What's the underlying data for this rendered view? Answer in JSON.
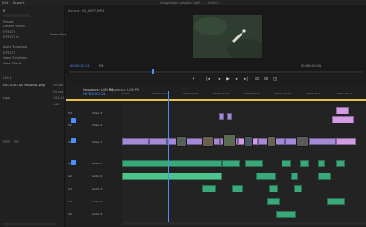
{
  "header": {
    "menu_left": "Edit",
    "menu_right": "Export",
    "project_title": "Vangellsen sessile Ouff",
    "project_state": "- Edited"
  },
  "left_panel": {
    "tab_label": "Ef",
    "rows": [
      "Presets",
      "Lumetri Presets",
      "EFFECTS",
      "EFFECTS in",
      "Audio Transitions",
      "EFFECTS",
      "Video Transitions",
      "Video Effects",
      "LDG 1",
      "LOG LOGO DE ORIGINAL.png",
      "Logo"
    ],
    "right_labels": [
      "5:0 sec",
      "6:0 sec",
      "1:01:11",
      "0:08"
    ],
    "frame_rate_label": "Frame Rate"
  },
  "monitor": {
    "source_label": "Source: GG_IMGT.MP4",
    "timecode_left": "00:00:03:21",
    "fit_label": "Fit",
    "timecode_right": "00:00:41:04",
    "playhead_percent": 28
  },
  "timeline": {
    "tabs": [
      "Sequence: LGH P4",
      "Sequence: LGH P5"
    ],
    "timecode": "00:00:03:21",
    "ruler_labels": [
      "00:00",
      "00:00:14:23",
      "00:00:29:23",
      "00:00:44:22",
      "00:00:59:22",
      "00:01:14:22",
      "00:01:29:21",
      "00:01:44:21"
    ],
    "track_labels": [
      "V3",
      "V2",
      "V1",
      "A1",
      "A2",
      "A3",
      "A4",
      "A5"
    ],
    "track_names": [
      "Video 3",
      "Video 2",
      "Video 1",
      "Audio 1",
      "Audio 2",
      "Audio 3",
      "Audio 4",
      "Audio 5"
    ],
    "playhead_percent": 19
  },
  "colors": {
    "video_clip": "#a48ad4",
    "video_clip_alt": "#d39de3",
    "audio_clip": "#3aa879",
    "playhead": "#4a8fff",
    "timecode": "#4a8fff"
  }
}
